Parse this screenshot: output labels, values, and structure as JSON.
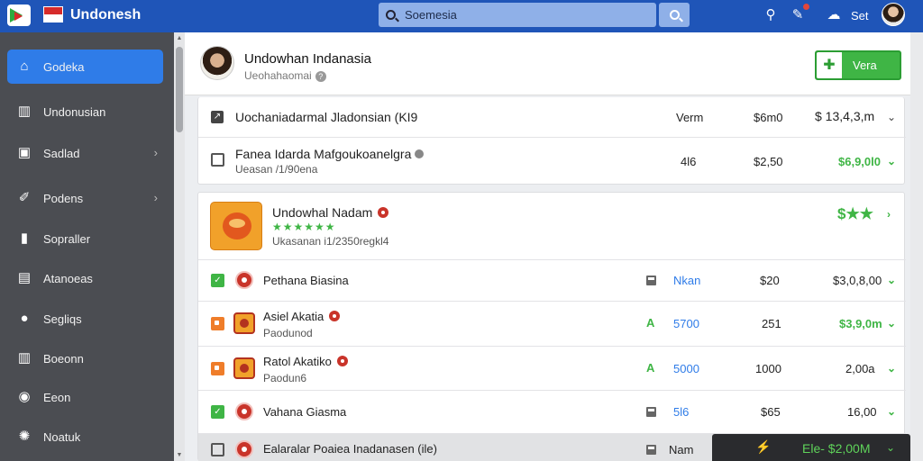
{
  "header": {
    "app_title": "Undonesh",
    "search_placeholder": "Soemesia",
    "settings_label": "Set"
  },
  "sidebar": {
    "items": [
      {
        "label": "Godeka",
        "icon": "home-icon"
      },
      {
        "label": "Undonusian",
        "icon": "book-icon"
      },
      {
        "label": "Sadlad",
        "icon": "folder-icon"
      },
      {
        "label": "Podens",
        "icon": "wrench-icon"
      },
      {
        "label": "Sopraller",
        "icon": "phone-icon"
      },
      {
        "label": "Atanoeas",
        "icon": "file-icon"
      },
      {
        "label": "Segliqs",
        "icon": "person-icon"
      },
      {
        "label": "Boeonn",
        "icon": "building-icon"
      },
      {
        "label": "Eeon",
        "icon": "globe-icon"
      },
      {
        "label": "Noatuk",
        "icon": "settings-icon"
      }
    ]
  },
  "profile": {
    "name": "Undowhan Indanasia",
    "subtitle": "Ueohahaomai",
    "action_label": "Vera"
  },
  "card1": {
    "rows": [
      {
        "title": "Uochaniadarmal Jladonsian (KI9",
        "col1": "Verm",
        "col2": "$6m0",
        "amount": "$ 13,4,3,m"
      },
      {
        "title": "Fanea Idarda Mafgoukoanelgra",
        "subtitle": "Ueasan /1/90ena",
        "col1": "4l6",
        "col2": "$2,50",
        "amount": "$6,9,0l0"
      }
    ]
  },
  "card2": {
    "header": {
      "title": "Undowhal Nadam",
      "stars": "★★★★★★",
      "subtitle": "Ukasanan i1/2350regkl4",
      "rating": "$★★"
    },
    "rows": [
      {
        "title": "Pethana Biasina",
        "col1": "Nkan",
        "col2": "$20",
        "amount": "$3,0,8,00"
      },
      {
        "title": "Asiel Akatia",
        "subtitle": "Paodunod",
        "col1": "5700",
        "col2": "251",
        "amount": "$3,9,0m"
      },
      {
        "title": "Ratol Akatiko",
        "subtitle": "Paodun6",
        "col1": "5000",
        "col2": "1000",
        "amount": "2,00a"
      },
      {
        "title": "Vahana Giasma",
        "col1": "5l6",
        "col2": "$65",
        "amount": "16,00"
      },
      {
        "title": "Ealaralar Poaiea Inadanasen (ile)",
        "col1": "Nam"
      }
    ]
  },
  "toast": {
    "text": "Ele- $2,00M"
  }
}
